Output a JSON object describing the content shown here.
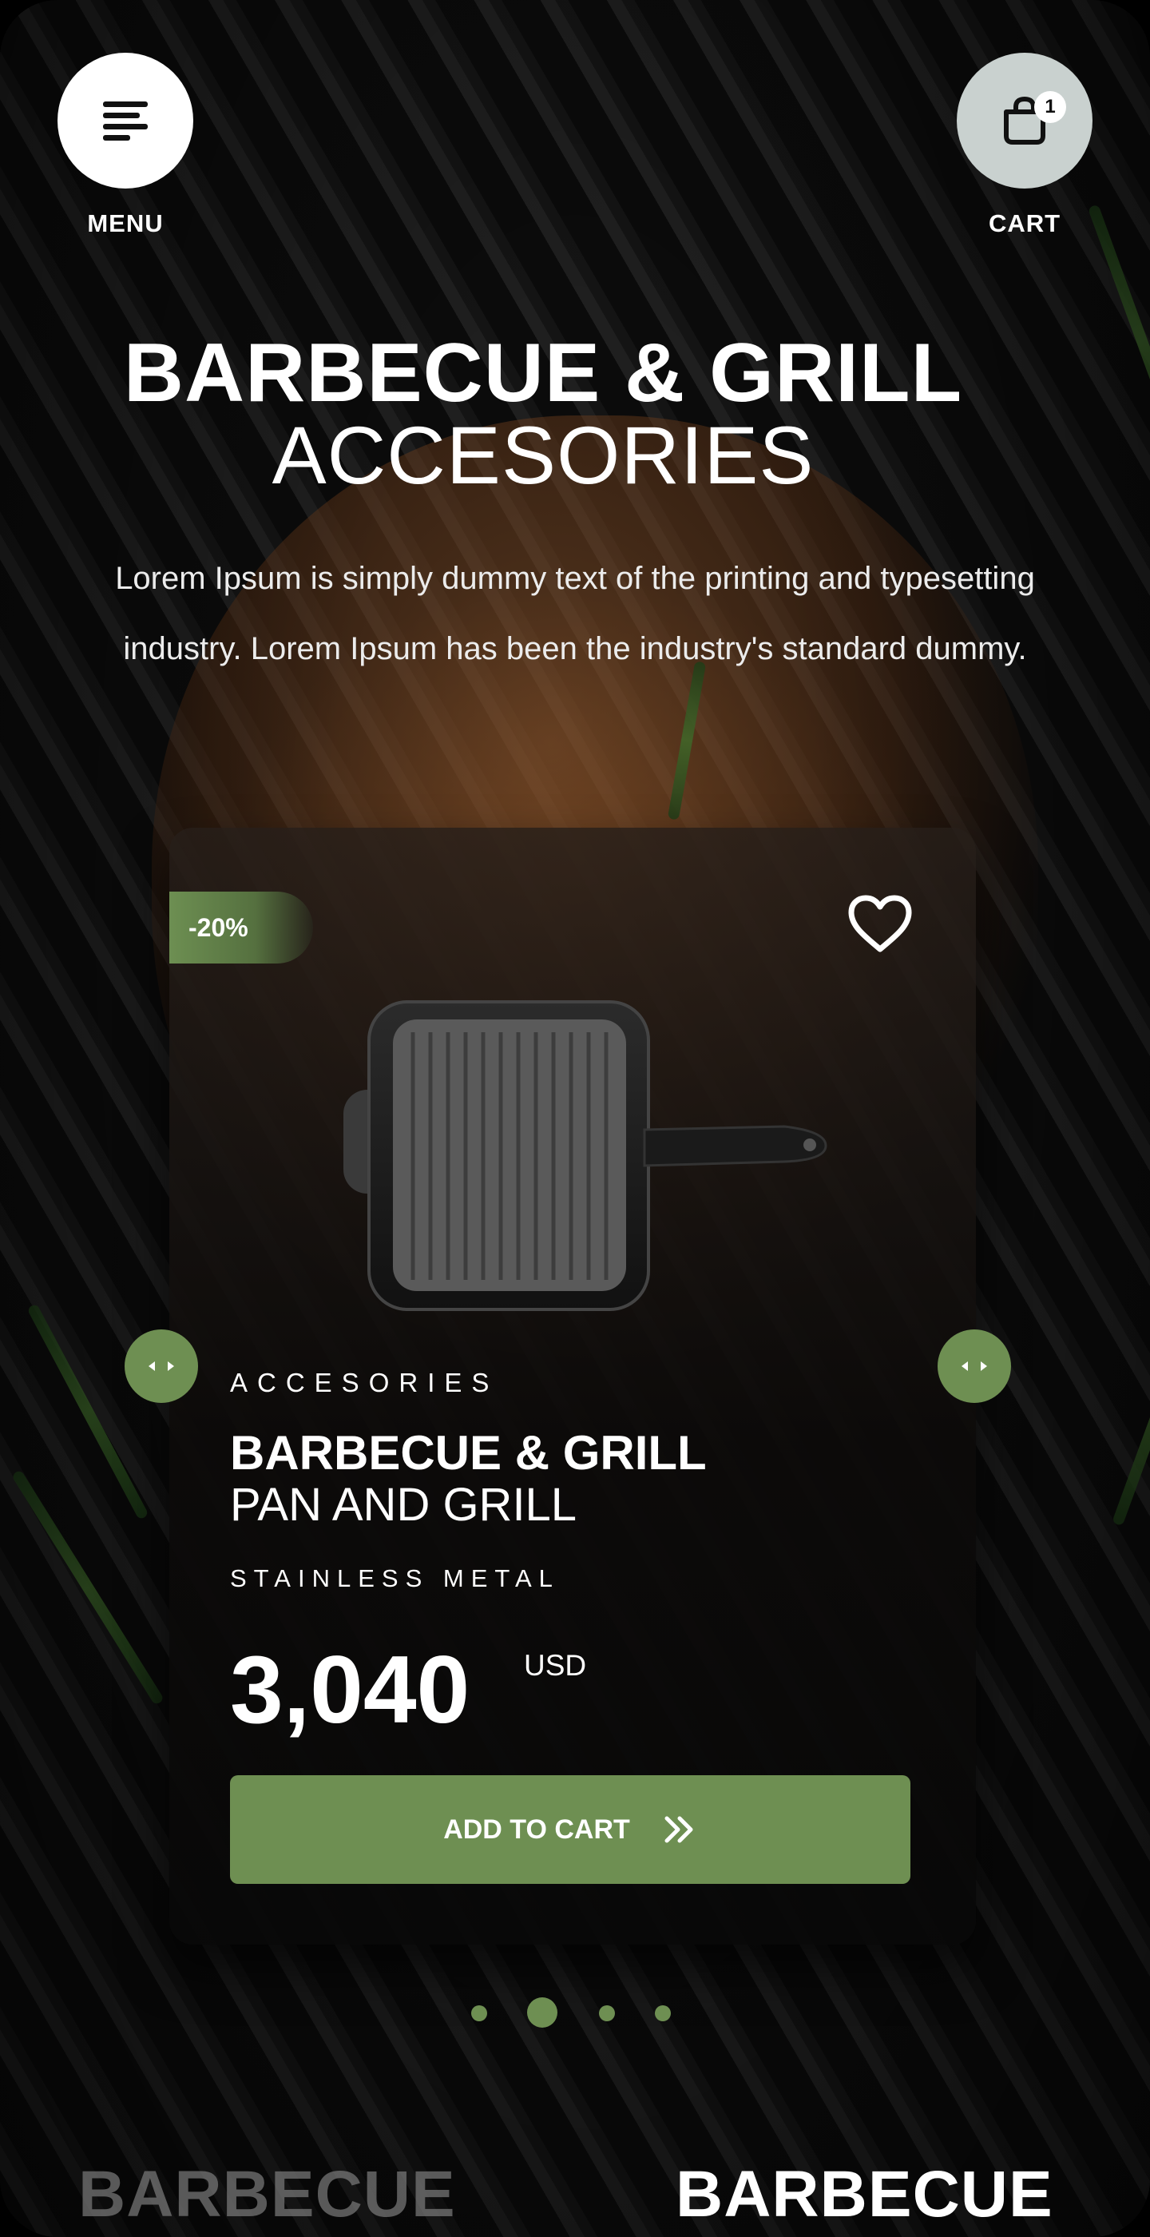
{
  "header": {
    "menu_label": "MENU",
    "cart_label": "CART",
    "cart_count": "1",
    "menu_icon": "menu-lines-icon",
    "cart_icon": "shopping-bag-icon"
  },
  "hero": {
    "title_line1": "BARBECUE & GRILL",
    "title_line2": "ACCESORIES",
    "description": "Lorem Ipsum is simply dummy text of the printing and typesetting industry. Lorem Ipsum has been the industry's standard dummy."
  },
  "product": {
    "discount": "-20%",
    "category": "ACCESORIES",
    "name_line1": "BARBECUE & GRILL",
    "name_line2": "PAN AND GRILL",
    "material": "STAINLESS METAL",
    "price": "3,040",
    "currency": "USD",
    "add_to_cart": "ADD TO CART",
    "add_to_cart_icon": "double-chevron-right-icon",
    "favorite_icon": "heart-icon"
  },
  "carousel": {
    "dot_count": 4,
    "active_index": 1
  },
  "marquee": {
    "words": [
      "BARBECUE",
      "BARBECUE"
    ]
  },
  "colors": {
    "accent": "#6e8f52",
    "cart_button_bg": "#c9d1cf",
    "background": "#0c0c0c"
  }
}
